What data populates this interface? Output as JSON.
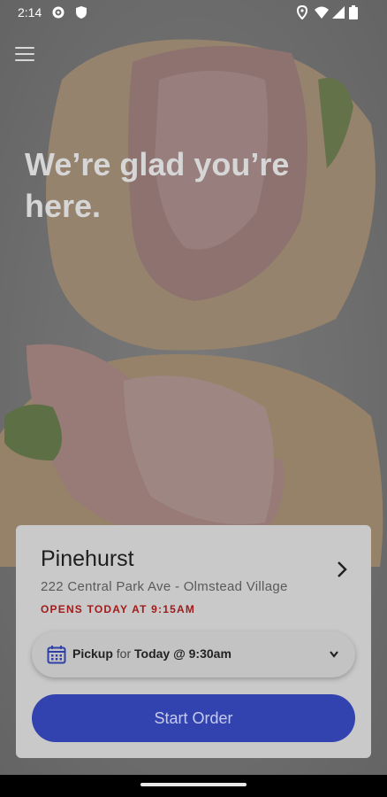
{
  "status_bar": {
    "time": "2:14"
  },
  "hero": {
    "headline_line1": "We’re glad you’re",
    "headline_line2": "here."
  },
  "store": {
    "name": "Pinehurst",
    "address": "222 Central Park Ave - Olmstead Village",
    "hours": "OPENS TODAY AT 9:15AM"
  },
  "pickup": {
    "mode": "Pickup",
    "connector": "for",
    "when": "Today @ 9:30am"
  },
  "cta": {
    "start_label": "Start Order"
  },
  "colors": {
    "accent": "#3243b0",
    "hours_red": "#a11b1b",
    "card_bg": "#c9c9c9"
  }
}
